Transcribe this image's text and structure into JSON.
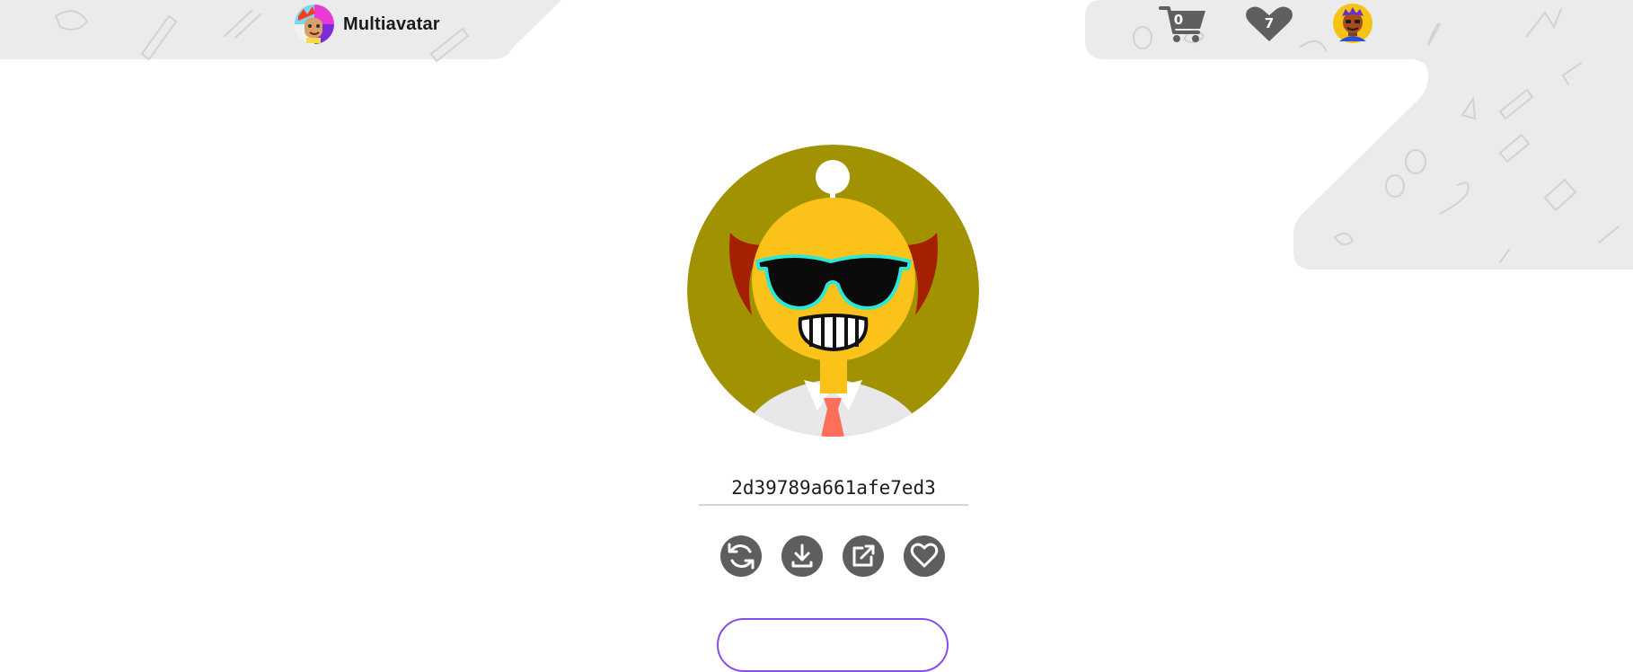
{
  "header": {
    "brand_name": "Multiavatar",
    "logo_icon": "multiavatar-logo-icon",
    "cart_count": "0",
    "favorites_count": "7",
    "cart_icon": "shopping-cart-icon",
    "favorites_icon": "heart-icon",
    "user_icon": "user-avatar-icon"
  },
  "avatar": {
    "hash": "2d39789a661afe7ed3",
    "colors": {
      "background": "#a09200",
      "face": "#fbc31a",
      "ears": "#a52000",
      "glasses_frame": "#2ee8d5",
      "tie": "#ff6e5a",
      "shirt": "#e8e8ea"
    }
  },
  "actions": [
    {
      "name": "refresh",
      "icon": "refresh-icon"
    },
    {
      "name": "download",
      "icon": "download-icon"
    },
    {
      "name": "open-external",
      "icon": "external-link-icon"
    },
    {
      "name": "favorite",
      "icon": "heart-outline-icon"
    }
  ],
  "theme": {
    "accent": "#8a4de8",
    "icon_gray": "#5e5e5e",
    "pattern_gray": "#ebebeb"
  }
}
